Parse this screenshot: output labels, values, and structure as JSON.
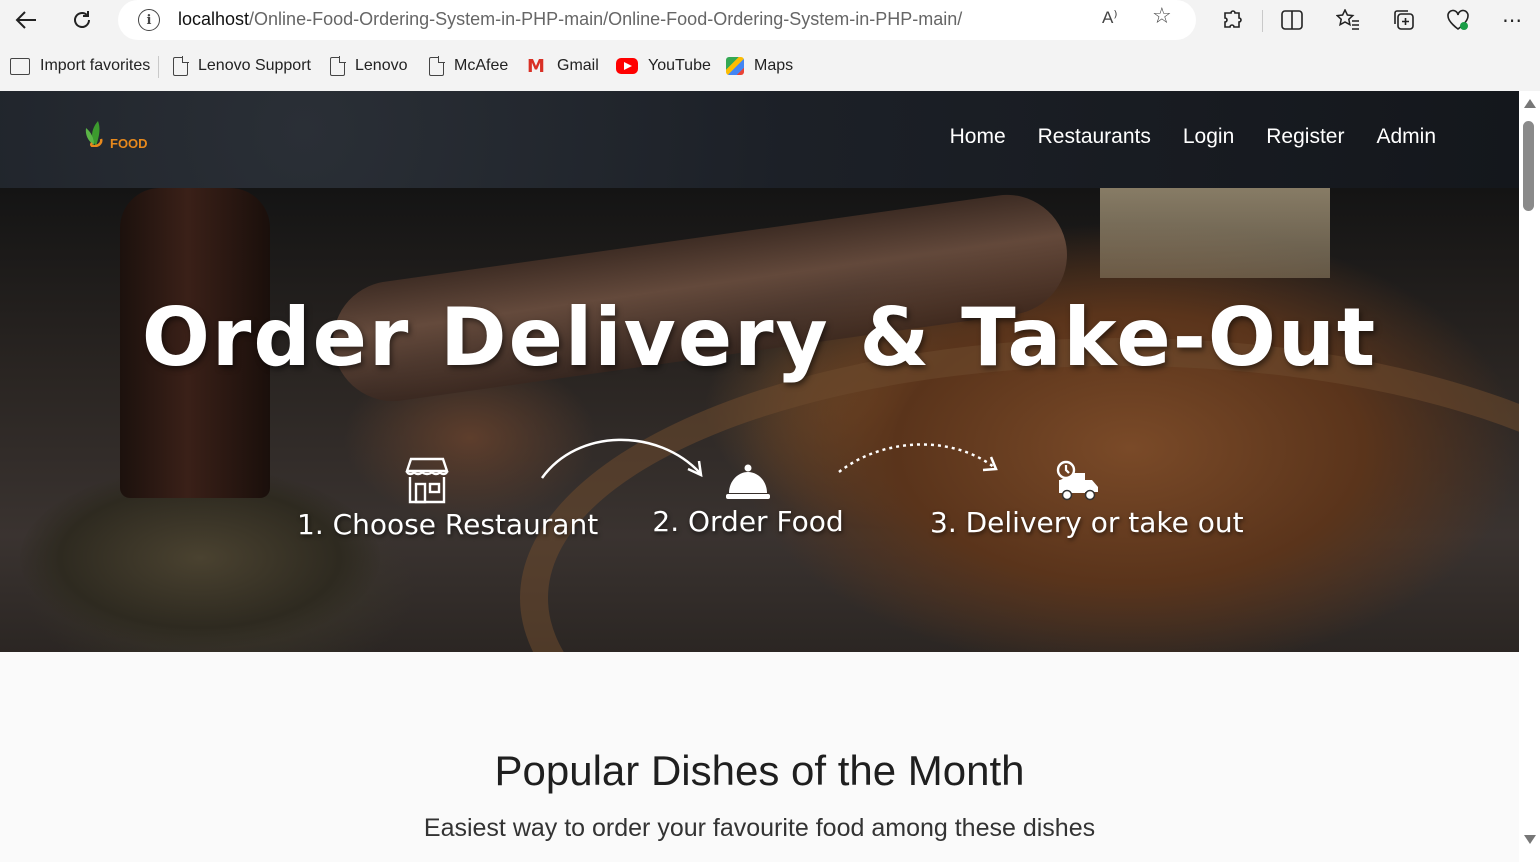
{
  "browser": {
    "url_host": "localhost",
    "url_path": "/Online-Food-Ordering-System-in-PHP-main/Online-Food-Ordering-System-in-PHP-main/",
    "read_aloud_label": "A⁾",
    "bookmarks": [
      {
        "label": "Import favorites",
        "icon": "import-icon"
      },
      {
        "label": "Lenovo Support",
        "icon": "page-icon"
      },
      {
        "label": "Lenovo",
        "icon": "page-icon"
      },
      {
        "label": "McAfee",
        "icon": "page-icon"
      },
      {
        "label": "Gmail",
        "icon": "gmail-icon"
      },
      {
        "label": "YouTube",
        "icon": "youtube-icon"
      },
      {
        "label": "Maps",
        "icon": "maps-icon"
      }
    ]
  },
  "site": {
    "logo_text": "FOOD",
    "nav": [
      "Home",
      "Restaurants",
      "Login",
      "Register",
      "Admin"
    ]
  },
  "hero": {
    "title": "Order Delivery & Take-Out",
    "steps": [
      {
        "label": "1. Choose Restaurant",
        "icon": "storefront-icon"
      },
      {
        "label": "2. Order Food",
        "icon": "food-cloche-icon"
      },
      {
        "label": "3. Delivery or take out",
        "icon": "delivery-truck-icon"
      }
    ]
  },
  "popular": {
    "title": "Popular Dishes of the Month",
    "subtitle": "Easiest way to order your favourite food among these dishes"
  },
  "colors": {
    "nav_bg": "#1c2027",
    "logo_orange": "#e8891c",
    "logo_green": "#3c9a2e"
  }
}
